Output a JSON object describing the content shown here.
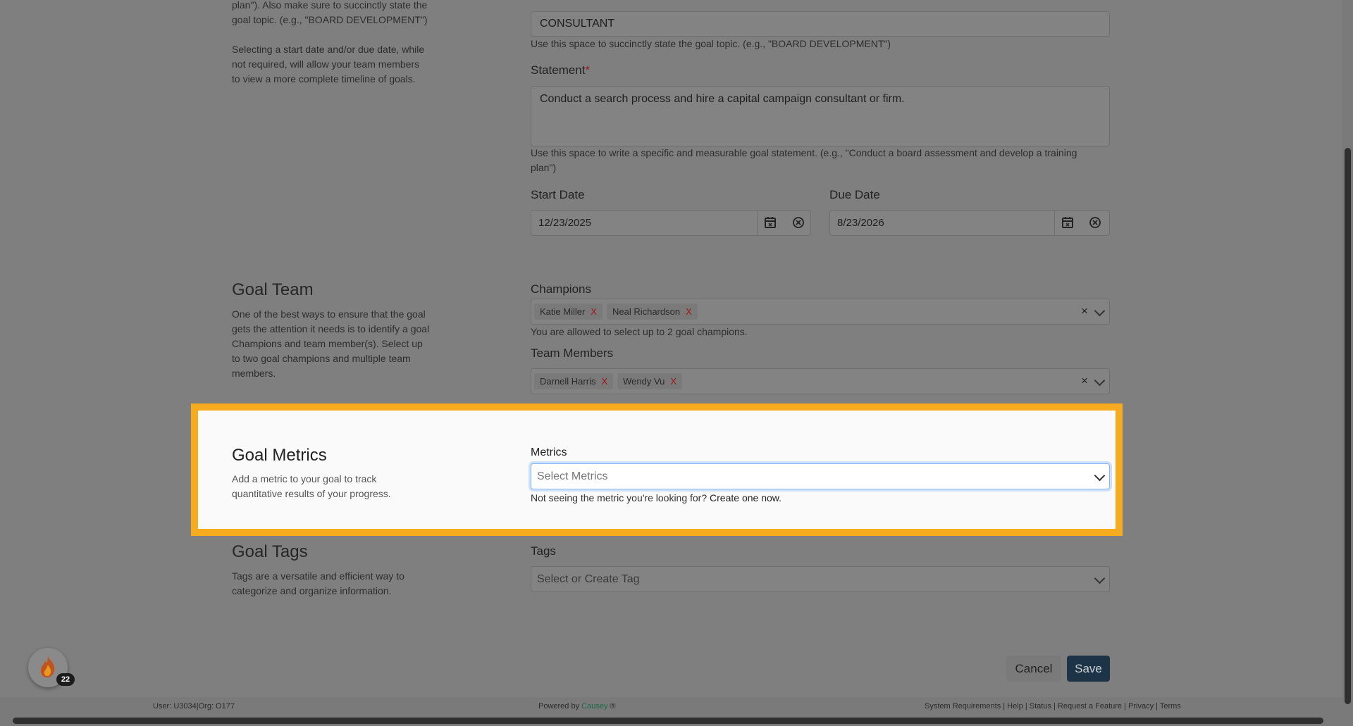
{
  "intro": {
    "line1": "plan\"). Also make sure to succinctly state the",
    "line2": "goal topic. (e.g., \"BOARD DEVELOPMENT\")",
    "line3": "Selecting a start date and/or due date, while",
    "line4": "not required, will allow your team members",
    "line5": "to view a more complete timeline of goals."
  },
  "topic": {
    "value": "CONSULTANT",
    "help": "Use this space to succinctly state the goal topic. (e.g., \"BOARD DEVELOPMENT\")"
  },
  "statement": {
    "label": "Statement",
    "required_mark": "*",
    "value": "Conduct a search process and hire a capital campaign consultant or firm.",
    "help_line1": "Use this space to write a specific and measurable goal statement. (e.g., \"Conduct a board assessment and develop a training",
    "help_line2": "plan\")"
  },
  "dates": {
    "start_label": "Start Date",
    "start_value": "12/23/2025",
    "due_label": "Due Date",
    "due_value": "8/23/2026"
  },
  "goal_team": {
    "title": "Goal Team",
    "desc": [
      "One of the best ways to ensure that the goal",
      "gets the attention it needs is to identify a goal",
      "Champions and team member(s). Select up",
      "to two goal champions and multiple team",
      "members."
    ],
    "champions_label": "Champions",
    "champions": [
      "Katie Miller",
      "Neal Richardson"
    ],
    "champions_help": "You are allowed to select up to 2 goal champions.",
    "members_label": "Team Members",
    "members": [
      "Darnell Harris",
      "Wendy Vu"
    ],
    "chip_remove": "X",
    "clear_symbol": "×"
  },
  "goal_metrics": {
    "title": "Goal Metrics",
    "desc_line1": "Add a metric to your goal to track",
    "desc_line2": "quantitative results of your progress.",
    "metrics_label": "Metrics",
    "placeholder": "Select Metrics",
    "help_prefix": "Not seeing the metric you're looking for?",
    "help_link": "Create one now."
  },
  "goal_tags": {
    "title": "Goal Tags",
    "desc_line1": "Tags are a versatile and efficient way to",
    "desc_line2": "categorize and organize information.",
    "tags_label": "Tags",
    "placeholder": "Select or Create Tag"
  },
  "actions": {
    "cancel": "Cancel",
    "save": "Save"
  },
  "badge": {
    "count": "22"
  },
  "footer": {
    "user": "User: U3034|Org: O177",
    "powered_prefix": "Powered by",
    "powered_brand": "Causey",
    "powered_suffix": "®",
    "links": "System Requirements | Help | Status | Request a Feature | Privacy | Terms"
  },
  "colors": {
    "highlight": "#f7ac1f",
    "save_button": "#1d3447",
    "brand": "#1e6b4a",
    "remove": "#a01515"
  },
  "icons": [
    "calendar-icon",
    "clear-circle-icon",
    "chevron-down-icon",
    "flame-icon"
  ]
}
